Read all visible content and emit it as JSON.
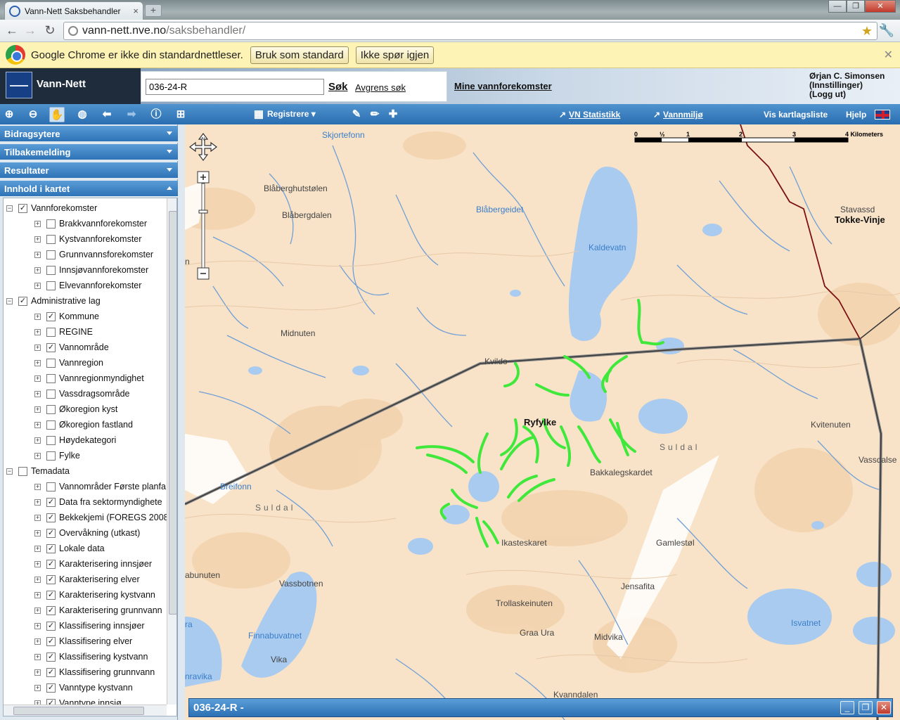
{
  "browser": {
    "tab_title": "Vann-Nett Saksbehandler",
    "url_host": "vann-nett.nve.no",
    "url_path": "/saksbehandler/",
    "infobar_text": "Google Chrome er ikke din standardnettleser.",
    "infobar_btn1": "Bruk som standard",
    "infobar_btn2": "Ikke spør igjen"
  },
  "app": {
    "name": "Vann-Nett",
    "search_value": "036-24-R",
    "search_button": "Søk",
    "refine_search": "Avgrens søk",
    "my_waterbodies": "Mine vannforekomster",
    "user_name": "Ørjan C. Simonsen",
    "user_settings": "(Innstillinger)",
    "user_logout": "(Logg ut)"
  },
  "toolbar": {
    "registrere": "Registrere",
    "vn_statistikk": "VN Statistikk",
    "vannmiljo": "Vannmiljø",
    "vis_kartlagsliste": "Vis kartlagsliste",
    "hjelp": "Hjelp"
  },
  "sidebar": {
    "panels": [
      "Bidragsytere",
      "Tilbakemelding",
      "Resultater",
      "Innhold i kartet"
    ],
    "tree": [
      {
        "label": "Vannforekomster",
        "level": 0,
        "checked": true
      },
      {
        "label": "Brakkvannforekomster",
        "level": 1,
        "checked": false
      },
      {
        "label": "Kystvannforekomster",
        "level": 1,
        "checked": false
      },
      {
        "label": "Grunnvannsforekomster",
        "level": 1,
        "checked": false
      },
      {
        "label": "Innsjøvannforekomster",
        "level": 1,
        "checked": false
      },
      {
        "label": "Elvevannforekomster",
        "level": 1,
        "checked": false
      },
      {
        "label": "Administrative lag",
        "level": 0,
        "checked": true
      },
      {
        "label": "Kommune",
        "level": 1,
        "checked": true
      },
      {
        "label": "REGINE",
        "level": 1,
        "checked": false
      },
      {
        "label": "Vannområde",
        "level": 1,
        "checked": true
      },
      {
        "label": "Vannregion",
        "level": 1,
        "checked": false
      },
      {
        "label": "Vannregionmyndighet",
        "level": 1,
        "checked": false
      },
      {
        "label": "Vassdragsområde",
        "level": 1,
        "checked": false
      },
      {
        "label": "Økoregion kyst",
        "level": 1,
        "checked": false
      },
      {
        "label": "Økoregion fastland",
        "level": 1,
        "checked": false
      },
      {
        "label": "Høydekategori",
        "level": 1,
        "checked": false
      },
      {
        "label": "Fylke",
        "level": 1,
        "checked": false
      },
      {
        "label": "Temadata",
        "level": 0,
        "checked": false
      },
      {
        "label": "Vannområder Første planfa",
        "level": 1,
        "checked": false
      },
      {
        "label": "Data fra sektormyndighete",
        "level": 1,
        "checked": true
      },
      {
        "label": "Bekkekjemi (FOREGS 2008",
        "level": 1,
        "checked": true
      },
      {
        "label": "Overvåkning (utkast)",
        "level": 1,
        "checked": true
      },
      {
        "label": "Lokale data",
        "level": 1,
        "checked": true
      },
      {
        "label": "Karakterisering innsjøer",
        "level": 1,
        "checked": true
      },
      {
        "label": "Karakterisering elver",
        "level": 1,
        "checked": true
      },
      {
        "label": "Karakterisering kystvann",
        "level": 1,
        "checked": true
      },
      {
        "label": "Karakterisering grunnvann",
        "level": 1,
        "checked": true
      },
      {
        "label": "Klassifisering innsjøer",
        "level": 1,
        "checked": true
      },
      {
        "label": "Klassifisering elver",
        "level": 1,
        "checked": true
      },
      {
        "label": "Klassifisering kystvann",
        "level": 1,
        "checked": true
      },
      {
        "label": "Klassifisering grunnvann",
        "level": 1,
        "checked": true
      },
      {
        "label": "Vanntype kystvann",
        "level": 1,
        "checked": true
      },
      {
        "label": "Vanntype innsjø",
        "level": 1,
        "checked": true
      }
    ]
  },
  "map": {
    "labels": [
      {
        "text": "Skjortefonn",
        "kind": "water"
      },
      {
        "text": "Blåberghutstølen",
        "kind": "place"
      },
      {
        "text": "Blåbergdalen",
        "kind": "place"
      },
      {
        "text": "Blåbergeidet",
        "kind": "water"
      },
      {
        "text": "Kaldevatn",
        "kind": "water"
      },
      {
        "text": "Tokke-Vinje",
        "kind": "big"
      },
      {
        "text": "Stavassd",
        "kind": "place"
      },
      {
        "text": "Midnuten",
        "kind": "place"
      },
      {
        "text": "Kvildo",
        "kind": "place"
      },
      {
        "text": "Ryfylke",
        "kind": "big"
      },
      {
        "text": "Suldal",
        "kind": "spaced"
      },
      {
        "text": "Bakkalegskardet",
        "kind": "place"
      },
      {
        "text": "Kvitenuten",
        "kind": "place"
      },
      {
        "text": "Vassdalse",
        "kind": "place"
      },
      {
        "text": "Breifonn",
        "kind": "water"
      },
      {
        "text": "Suldal",
        "kind": "spaced"
      },
      {
        "text": "Ikasteskaret",
        "kind": "place"
      },
      {
        "text": "Gamlestøl",
        "kind": "place"
      },
      {
        "text": "abunuten",
        "kind": "place"
      },
      {
        "text": "Vassbotnen",
        "kind": "place"
      },
      {
        "text": "Jensafita",
        "kind": "place"
      },
      {
        "text": "Trollaskeinuten",
        "kind": "place"
      },
      {
        "text": "Isvatnet",
        "kind": "water"
      },
      {
        "text": "Finnabuvatnet",
        "kind": "water"
      },
      {
        "text": "Graa Ura",
        "kind": "place"
      },
      {
        "text": "Midvika",
        "kind": "place"
      },
      {
        "text": "Vika",
        "kind": "place"
      },
      {
        "text": "nravika",
        "kind": "water"
      },
      {
        "text": "Kvanndalen",
        "kind": "place"
      },
      {
        "text": "n",
        "kind": "place"
      },
      {
        "text": "ra",
        "kind": "water"
      }
    ],
    "scale_ticks": [
      "0",
      "½",
      "1",
      "2",
      "3",
      "4 Kilometers"
    ],
    "highlight_color": "#3fe83a",
    "water_color": "#a9cbf0",
    "land_color": "#f8e3c8",
    "boundary_color": "#3a3a3a",
    "county_color": "#7a1010"
  },
  "bottom_window": {
    "title": "036-24-R -"
  }
}
